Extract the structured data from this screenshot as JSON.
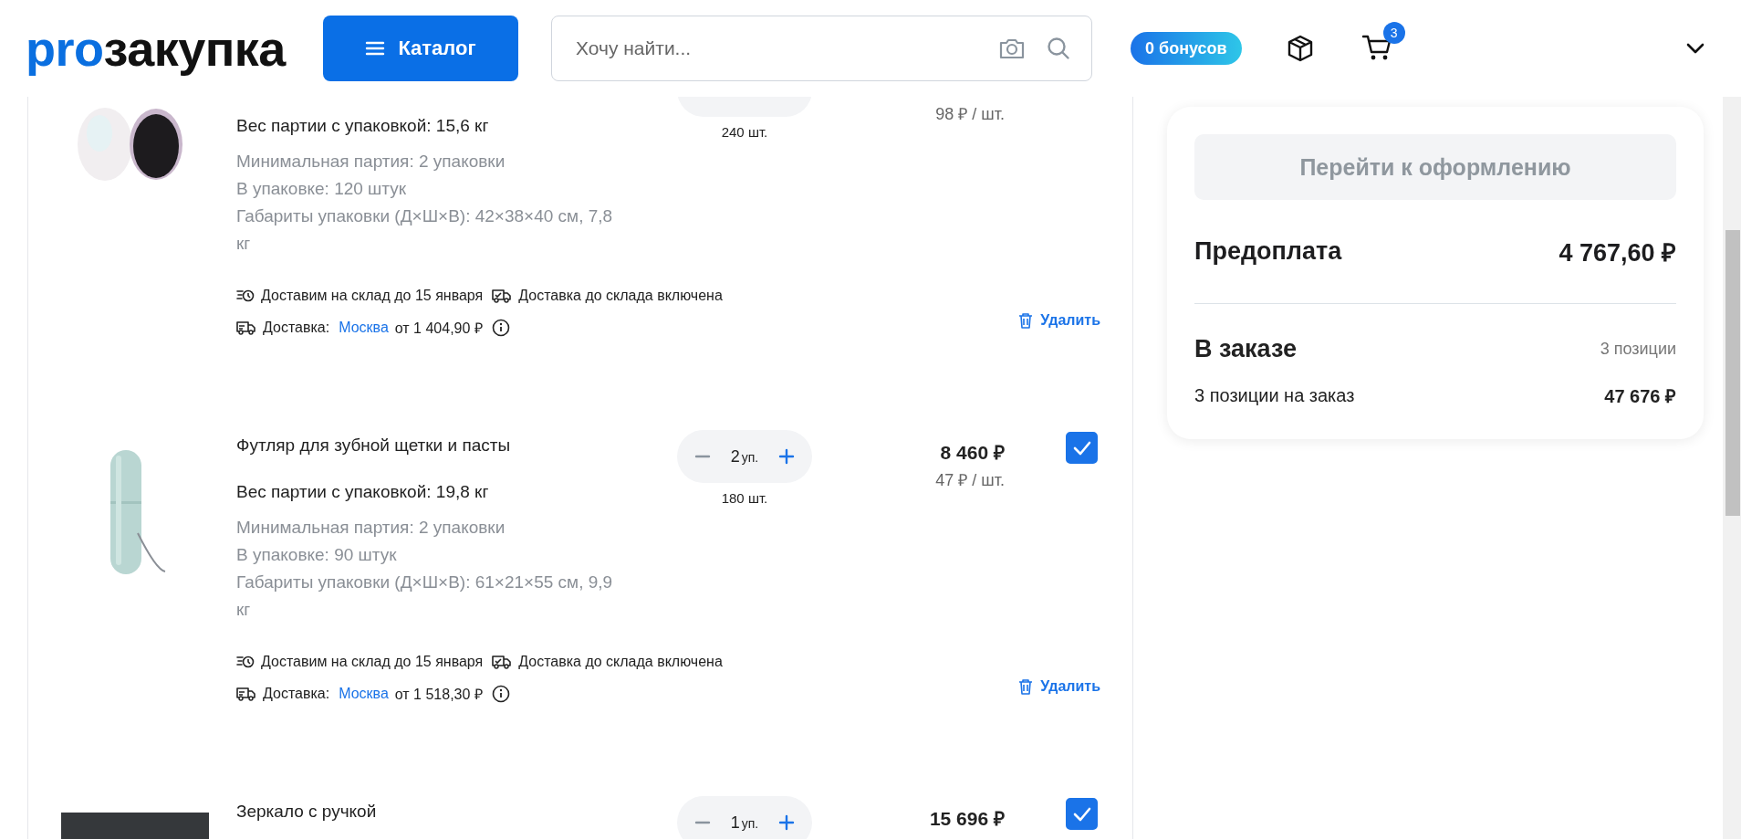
{
  "header": {
    "logo_prefix": "pro",
    "logo_rest": "закупка",
    "catalog_button": "Каталог",
    "search": {
      "placeholder": "Хочу найти..."
    },
    "bonus": "0 бонусов",
    "cart_count": "3"
  },
  "items": [
    {
      "weight": "Вес партии с упаковкой: 15,6 кг",
      "details": [
        "Минимальная партия: 2 упаковки",
        "В упаковке: 120 штук",
        "Габариты упаковки (Д×Ш×В): 42×38×40 см, 7,8 кг"
      ],
      "eta": "Доставим на склад до 15 января",
      "included": "Доставка до склада включена",
      "delivery_label": "Доставка:",
      "city": "Москва",
      "delivery_price": "от 1 404,90 ₽",
      "pieces": "240 шт.",
      "unit_price": "98 ₽ / шт.",
      "delete": "Удалить"
    },
    {
      "title": "Футляр для зубной щетки и пасты",
      "weight": "Вес партии с упаковкой: 19,8 кг",
      "details": [
        "Минимальная партия: 2 упаковки",
        "В упаковке: 90 штук",
        "Габариты упаковки (Д×Ш×В): 61×21×55 см, 9,9 кг"
      ],
      "eta": "Доставим на склад до 15 января",
      "included": "Доставка до склада включена",
      "delivery_label": "Доставка:",
      "city": "Москва",
      "delivery_price": "от 1 518,30 ₽",
      "qty": "2",
      "unit": "уп.",
      "pieces": "180 шт.",
      "total": "8 460 ₽",
      "unit_price": "47 ₽ / шт.",
      "checked": true,
      "delete": "Удалить"
    },
    {
      "title": "Зеркало с ручкой",
      "qty": "1",
      "unit": "уп.",
      "total": "15 696 ₽",
      "checked": true
    }
  ],
  "summary": {
    "checkout_button": {
      "label": "Перейти к оформлению",
      "disabled": true
    },
    "prepay_label": "Предоплата",
    "prepay_value": "4 767,60 ₽",
    "order_title": "В заказе",
    "order_count": "3 позиции",
    "order_line_label": "3 позиции на заказ",
    "order_line_value": "47 676 ₽"
  }
}
